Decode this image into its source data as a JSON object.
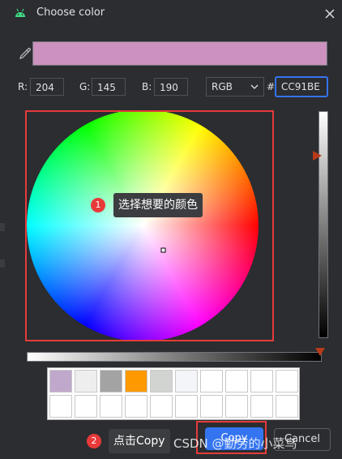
{
  "window": {
    "title": "Choose color",
    "app_icon": "android-icon",
    "close_icon": "close-icon"
  },
  "pipette_icon": "pipette-icon",
  "current_color": "#CC91BE",
  "rgb": {
    "r_label": "R:",
    "r_value": "204",
    "g_label": "G:",
    "g_value": "145",
    "b_label": "B:",
    "b_value": "190"
  },
  "mode_select": {
    "value": "RGB",
    "icon": "chevron-down-icon"
  },
  "hex": {
    "label": "#",
    "value": "CC91BE"
  },
  "annotations": [
    {
      "number": "1",
      "text": "选择想要的颜色"
    },
    {
      "number": "2",
      "text": "点击Copy"
    }
  ],
  "swatch_colors": [
    "#C0A8CC",
    "#EEEEEE",
    "#A3A3A3",
    "#FF9900",
    "#D2D4D2",
    "#F3F5F8",
    "#FFFFFF",
    "#FFFFFF",
    "#FFFFFF",
    "#FFFFFF",
    "#FFFFFF",
    "#FFFFFF",
    "#FFFFFF",
    "#FFFFFF",
    "#FFFFFF",
    "#FFFFFF",
    "#FFFFFF",
    "#FFFFFF",
    "#FFFFFF",
    "#FFFFFF"
  ],
  "buttons": {
    "ok_label": "Copy",
    "cancel_label": "Cancel"
  },
  "watermark": "CSDN @勤劳的小菜鸟",
  "colors": {
    "accent": "#3574F0",
    "highlight_frame": "#E53B3B",
    "badge": "#E8393A",
    "thumb": "#B83A1A"
  }
}
